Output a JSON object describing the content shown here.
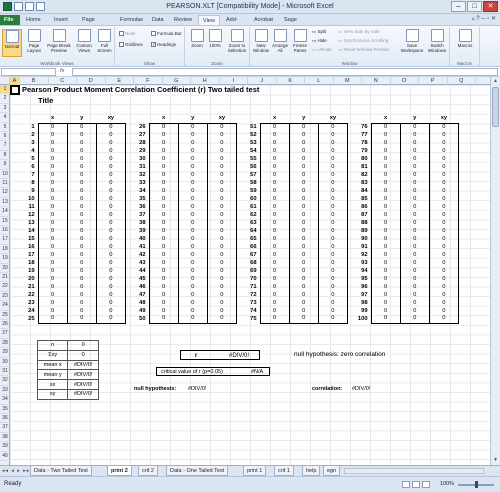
{
  "window": {
    "title": "PEARSON.XLT  [Compatibility Mode]  -  Microsoft Excel",
    "controls": {
      "minimize": "–",
      "maximize": "□",
      "close": "✕"
    }
  },
  "ribbon_tabs": [
    "File",
    "Home",
    "Insert",
    "Page Layout",
    "Formulas",
    "Data",
    "Review",
    "View",
    "Add-Ins",
    "Acrobat",
    "Sage"
  ],
  "active_tab": "View",
  "ribbon": {
    "workbook_views": {
      "label": "Workbook Views",
      "buttons": [
        "Normal",
        "Page Layout",
        "Page Break Preview",
        "Custom Views",
        "Full Screen"
      ]
    },
    "show": {
      "label": "Show",
      "ruler": "Ruler",
      "formula_bar": "Formula Bar",
      "gridlines": "Gridlines",
      "headings": "Headings"
    },
    "zoom": {
      "label": "Zoom",
      "buttons": [
        "Zoom",
        "100%",
        "Zoom to Selection"
      ]
    },
    "window": {
      "label": "Window",
      "buttons": [
        "New Window",
        "Arrange All",
        "Freeze Panes"
      ],
      "split": "Split",
      "hide": "Hide",
      "unhide": "Unhide",
      "side_by_side": "View Side by Side",
      "sync_scroll": "Synchronous Scrolling",
      "reset_pos": "Reset Window Position",
      "save_ws": "Save Workspace",
      "switch": "Switch Windows"
    },
    "macros": {
      "label": "Macros",
      "button": "Macros"
    }
  },
  "columns": [
    "A",
    "B",
    "C",
    "D",
    "E",
    "F",
    "G",
    "H",
    "I",
    "J",
    "K",
    "L",
    "M",
    "N",
    "O",
    "P",
    "Q"
  ],
  "sheet": {
    "title": "Pearson Product Moment Correlation Coefficient (r) Two tailed test",
    "subtitle": "Title",
    "table_headers": [
      "x",
      "y",
      "xy"
    ],
    "cell_value": "0",
    "stats": [
      {
        "label": "n",
        "value": "0"
      },
      {
        "label": "Σxy",
        "value": "0"
      },
      {
        "label": "mean x",
        "value": "#DIV/0!"
      },
      {
        "label": "mean y",
        "value": "#DIV/0!"
      },
      {
        "label": "sx",
        "value": "#DIV/0!"
      },
      {
        "label": "sy",
        "value": "#DIV/0!"
      }
    ],
    "r_label": "r",
    "r_value": "#DIV/0!",
    "null_hypothesis_text": "null hypothesis: zero correlation",
    "critical_label": "critical value of r (p=0.05)",
    "critical_value": "#N/A",
    "null_hyp_result_label": "null hypothesis:",
    "null_hyp_result_value": "#DIV/0!",
    "correlation_label": "correlation:",
    "correlation_value": "#DIV/0!"
  },
  "sheet_tabs": [
    "Data - Two Tailed Test",
    "print 2",
    "crit 2",
    "Data - One Tailed Test",
    "print 1",
    "crit 1",
    "help",
    "egn"
  ],
  "active_sheet_tab": "print 2",
  "status": {
    "ready": "Ready",
    "zoom": "100%"
  }
}
